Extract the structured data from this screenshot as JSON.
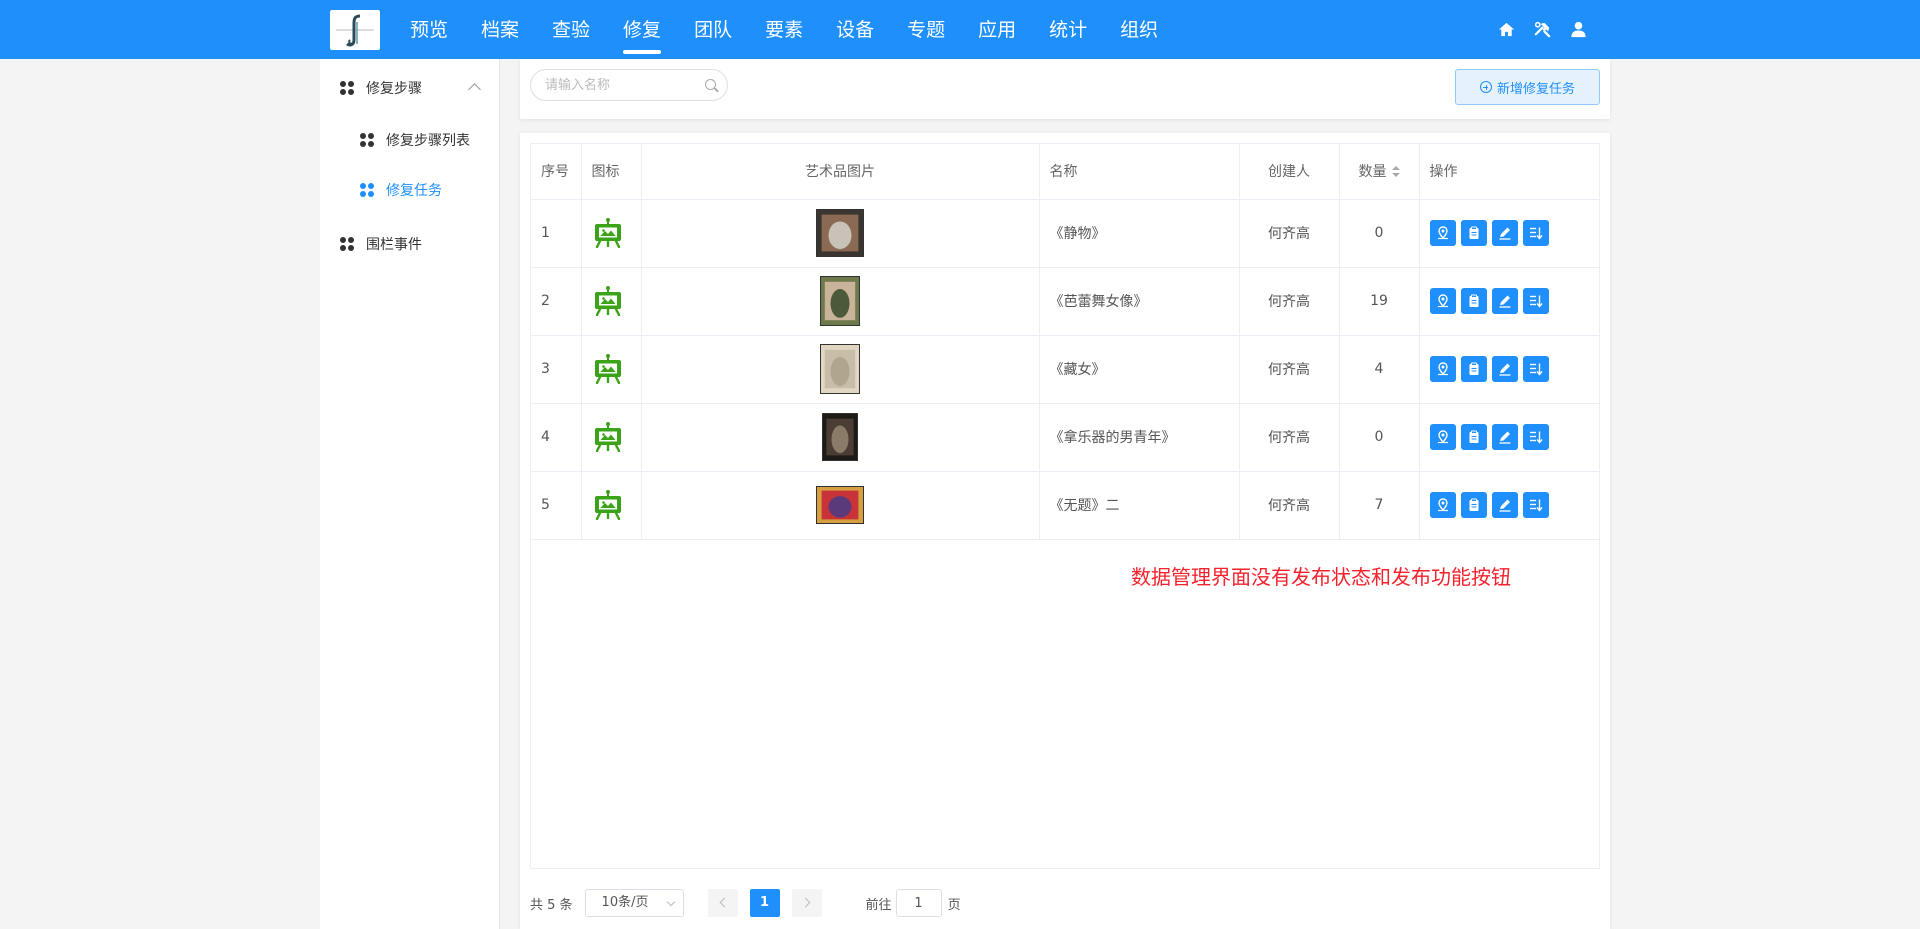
{
  "nav": {
    "items": [
      "预览",
      "档案",
      "查验",
      "修复",
      "团队",
      "要素",
      "设备",
      "专题",
      "应用",
      "统计",
      "组织"
    ],
    "active": "修复",
    "right_icons": [
      "home-icon",
      "tools-icon",
      "user-icon"
    ]
  },
  "sidebar": {
    "group_label": "修复步骤",
    "sub_items": [
      "修复步骤列表",
      "修复任务"
    ],
    "active_item": "修复任务",
    "other_label": "围栏事件"
  },
  "search": {
    "placeholder": "请输入名称"
  },
  "add_button": {
    "label": "新增修复任务"
  },
  "table": {
    "headers": {
      "index": "序号",
      "icon": "图标",
      "image": "艺术品图片",
      "name": "名称",
      "creator": "创建人",
      "count": "数量",
      "actions": "操作"
    },
    "rows": [
      {
        "index": "1",
        "name": "《静物》",
        "creator": "何齐高",
        "count": "0",
        "thumb_colors": [
          "#3a3530",
          "#8b6a55",
          "#c9c2b8"
        ]
      },
      {
        "index": "2",
        "name": "《芭蕾舞女像》",
        "creator": "何齐高",
        "count": "19",
        "thumb_colors": [
          "#6f7a4a",
          "#c9b39a",
          "#4a5a3a"
        ]
      },
      {
        "index": "3",
        "name": "《藏女》",
        "creator": "何齐高",
        "count": "4",
        "thumb_colors": [
          "#e0d6c2",
          "#c8bda6",
          "#b0a58e"
        ]
      },
      {
        "index": "4",
        "name": "《拿乐器的男青年》",
        "creator": "何齐高",
        "count": "0",
        "thumb_colors": [
          "#1e1a16",
          "#4a3e34",
          "#8a7a68"
        ]
      },
      {
        "index": "5",
        "name": "《无题》二",
        "creator": "何齐高",
        "count": "7",
        "thumb_colors": [
          "#d4a040",
          "#c8333a",
          "#5a3a7a"
        ]
      }
    ],
    "row_action_icons": [
      "map-pin-icon",
      "clipboard-icon",
      "edit-icon",
      "sort-icon"
    ]
  },
  "note": "数据管理界面没有发布状态和发布功能按钮",
  "pagination": {
    "total_label": "共 5 条",
    "page_size": "10条/页",
    "current_page": "1",
    "goto_label": "前往",
    "goto_value": "1",
    "page_suffix": "页"
  },
  "colors": {
    "primary": "#1e8ffb",
    "icon_green": "#3aa317",
    "note_red": "#f5222d"
  }
}
